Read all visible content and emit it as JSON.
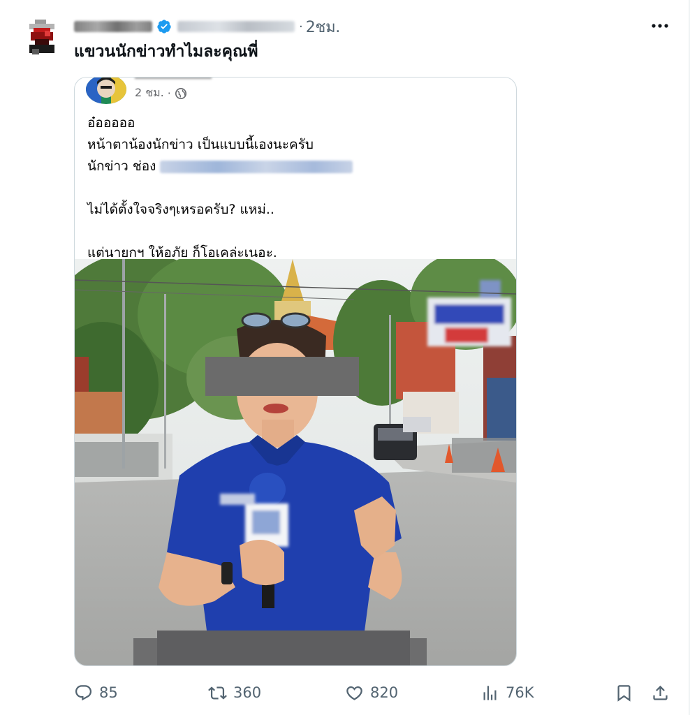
{
  "post": {
    "time": "2ชม.",
    "separator": "·",
    "text": "แขวนนักข่าวทำไมละคุณพี่"
  },
  "embedded_post": {
    "time": "2 ชม.",
    "separator": "·",
    "lines": [
      "อ๋อออออ",
      "หน้าตาน้องนักข่าว เป็นแบบนี้เองนะครับ",
      "นักข่าว ช่อง",
      "ไม่ได้ตั้งใจจริงๆเหรอครับ? แหม่..",
      "แต่นายกฯ ให้อภัย ก็โอเคล่ะเนอะ."
    ]
  },
  "actions": {
    "replies": "85",
    "reposts": "360",
    "likes": "820",
    "views": "76K"
  },
  "colors": {
    "text": "#0f1419",
    "muted": "#536471",
    "verified": "#1d9bf0",
    "card_border": "#cfd9de",
    "shirt": "#1f3fae"
  },
  "icons": [
    "verified-badge-icon",
    "more-icon",
    "globe-icon",
    "reply-icon",
    "repost-icon",
    "like-icon",
    "views-icon",
    "bookmark-icon",
    "share-icon"
  ]
}
